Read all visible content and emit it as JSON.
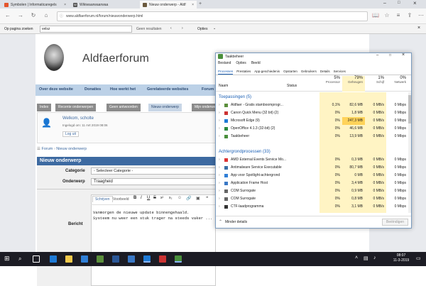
{
  "browser": {
    "tabs": [
      {
        "label": "Symbolen | Informaticaregels",
        "active": false
      },
      {
        "label": "Wikiwaarwaarwaa",
        "active": false
      },
      {
        "label": "Nieuw onderwerp - Aldf",
        "active": true
      }
    ],
    "url": "www.aldfaerforum.nl/forum/nieuwonderwerp.html"
  },
  "findbar": {
    "label": "Op pagina zoeken",
    "query": "velsz",
    "result": "Geen resultaten",
    "options": "Opties"
  },
  "site": {
    "title": "Aldfaerforum",
    "menu": [
      "Over deze website",
      "Donaties",
      "Hoe werkt het",
      "Gerelateerde websites",
      "Forum"
    ],
    "tabs": [
      "Index",
      "Recente onderwerpen",
      "Geen antwoorden",
      "Nieuw onderwerp",
      "Mijn onderwerpen"
    ],
    "welcome": "Welkom, scholte",
    "last_login": "Ingelogd om: 11 mrt 2019 08:06",
    "logout": "Log uit",
    "breadcrumb": [
      "Forum",
      "Nieuw onderwerp"
    ],
    "section": "Nieuw onderwerp",
    "category_label": "Categorie",
    "category_value": "- Selecteer Categorie -",
    "subject_label": "Onderwerp",
    "subject_value": "Traagheid",
    "message_label": "Bericht",
    "editor_tabs": [
      "Schrijven",
      "Voorbeeld"
    ],
    "editor_tools": [
      "B",
      "I",
      "U",
      "S",
      "x²",
      "x₂"
    ],
    "message_lines": [
      "Vanmorgen de nieuwe update binnengehaald.",
      "Systeem nu weer een stuk trager na steeds vaker ..."
    ]
  },
  "taskmanager": {
    "title": "Taakbeheer",
    "menu": [
      "Bestand",
      "Opties",
      "Beeld"
    ],
    "tabs": [
      "Processen",
      "Prestaties",
      "App-geschiedenis",
      "Opstarten",
      "Gebruikers",
      "Details",
      "Services"
    ],
    "columns": [
      {
        "pct": "",
        "name": "Naam"
      },
      {
        "pct": "",
        "name": "Status"
      },
      {
        "pct": "5%",
        "name": "Processor"
      },
      {
        "pct": "79%",
        "name": "Geheugen"
      },
      {
        "pct": "1%",
        "name": "Schijf"
      },
      {
        "pct": "0%",
        "name": "Netwerk"
      }
    ],
    "apps_header": "Toepassingen (5)",
    "apps": [
      {
        "name": "Aldfaer - Gratis stamboomprogr...",
        "cpu": "0,1%",
        "mem": "82,6 MB",
        "disk": "0 MB/s",
        "net": "0 Mbps"
      },
      {
        "name": "Canon Quick Menu (32 bit) (2)",
        "cpu": "0%",
        "mem": "1,8 MB",
        "disk": "0 MB/s",
        "net": "0 Mbps"
      },
      {
        "name": "Microsoft Edge (9)",
        "cpu": "0%",
        "mem": "247,3 MB",
        "disk": "0 MB/s",
        "net": "0 Mbps"
      },
      {
        "name": "OpenOffice 4.1.3 (32-bit) (2)",
        "cpu": "0%",
        "mem": "46,6 MB",
        "disk": "0 MB/s",
        "net": "0 Mbps"
      },
      {
        "name": "Taakbeheer",
        "cpu": "0%",
        "mem": "13,9 MB",
        "disk": "0 MB/s",
        "net": "0 Mbps"
      }
    ],
    "bg_header": "Achtergrondprocessen (33)",
    "bg": [
      {
        "name": "AMD External Events Service Mo...",
        "cpu": "0%",
        "mem": "0,3 MB",
        "disk": "0 MB/s",
        "net": "0 Mbps"
      },
      {
        "name": "Antimalware Service Executable",
        "cpu": "0%",
        "mem": "80,7 MB",
        "disk": "0 MB/s",
        "net": "0 Mbps"
      },
      {
        "name": "App voor Spotlight-achtergrond",
        "cpu": "0%",
        "mem": "0 MB",
        "disk": "0 MB/s",
        "net": "0 Mbps"
      },
      {
        "name": "Application Frame Host",
        "cpu": "0%",
        "mem": "3,4 MB",
        "disk": "0 MB/s",
        "net": "0 Mbps"
      },
      {
        "name": "COM Surrogate",
        "cpu": "0%",
        "mem": "0,9 MB",
        "disk": "0 MB/s",
        "net": "0 Mbps"
      },
      {
        "name": "COM Surrogate",
        "cpu": "0%",
        "mem": "0,8 MB",
        "disk": "0 MB/s",
        "net": "0 Mbps"
      },
      {
        "name": "CTF-laadprogramma",
        "cpu": "0%",
        "mem": "3,1 MB",
        "disk": "0 MB/s",
        "net": "0 Mbps"
      }
    ],
    "fewer_details": "Minder details",
    "end_task": "Beëindigen"
  },
  "taskbar": {
    "time": "08:07",
    "date": "11-3-2019"
  },
  "colors": {
    "tm_heat": "#fff4c4",
    "tm_heat_strong": "#ffd35a",
    "forum_blue": "#3d6aa1"
  }
}
